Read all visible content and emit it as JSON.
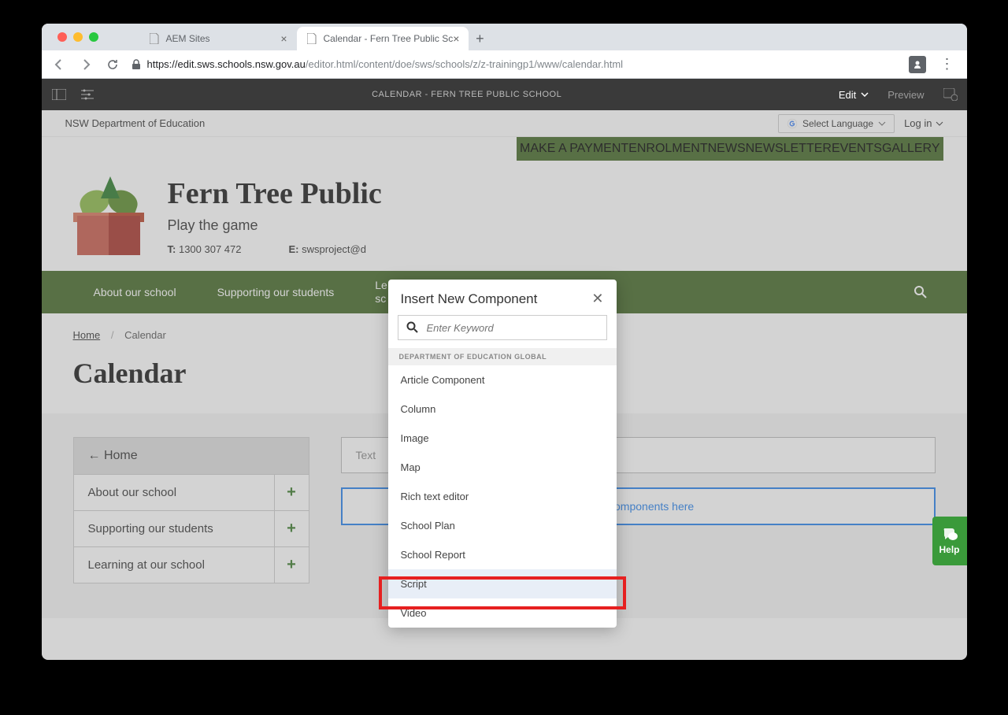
{
  "browser": {
    "tabs": [
      {
        "title": "AEM Sites",
        "active": false
      },
      {
        "title": "Calendar - Fern Tree Public Sc",
        "active": true
      }
    ],
    "url_host": "edit.sws.schools.nsw.gov.au",
    "url_path": "/editor.html/content/doe/sws/schools/z/z-trainingp1/www/calendar.html"
  },
  "aem": {
    "title": "CALENDAR - FERN TREE PUBLIC SCHOOL",
    "edit_label": "Edit",
    "preview_label": "Preview"
  },
  "dept": {
    "name": "NSW Department of Education",
    "lang_label": "Select Language",
    "login_label": "Log in"
  },
  "topnav": [
    "MAKE A PAYMENT",
    "ENROLMENT",
    "NEWS",
    "NEWSLETTER",
    "EVENTS",
    "GALLERY"
  ],
  "school": {
    "name": "Fern Tree Public",
    "tagline": "Play the game",
    "phone_label": "T:",
    "phone": "1300 307 472",
    "email_label": "E:",
    "email": "swsproject@d"
  },
  "mainnav": [
    "About our school",
    "Supporting our students",
    "Le\nsc"
  ],
  "breadcrumb": {
    "home": "Home",
    "current": "Calendar"
  },
  "page_title": "Calendar",
  "sidebar": {
    "home": "Home",
    "items": [
      "About our school",
      "Supporting our students",
      "Learning at our school"
    ]
  },
  "main_col": {
    "text_placeholder": "Text",
    "dropzone_label": "Drag components here"
  },
  "modal": {
    "title": "Insert New Component",
    "search_placeholder": "Enter Keyword",
    "group": "DEPARTMENT OF EDUCATION GLOBAL",
    "items": [
      "Article Component",
      "Column",
      "Image",
      "Map",
      "Rich text editor",
      "School Plan",
      "School Report",
      "Script",
      "Video"
    ],
    "highlighted_index": 7
  },
  "help_label": "Help"
}
